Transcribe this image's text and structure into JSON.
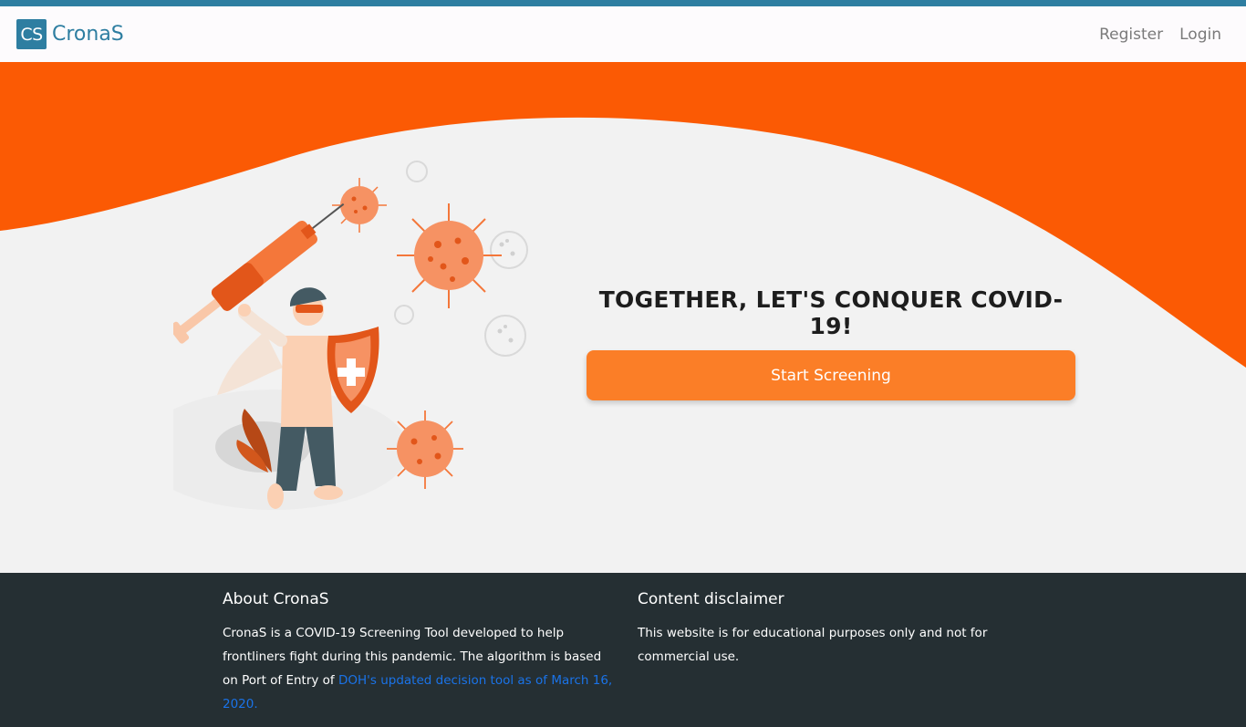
{
  "nav": {
    "brand_badge": "CS",
    "brand_name": "CronaS",
    "register_label": "Register",
    "login_label": "Login"
  },
  "hero": {
    "headline": "TOGETHER, LET'S CONQUER COVID-19!",
    "cta_label": "Start Screening"
  },
  "footer": {
    "about_title": "About CronaS",
    "about_text": "CronaS is a COVID-19 Screening Tool developed to help frontliners fight during this pandemic. The algorithm is based on Port of Entry of ",
    "about_link": "DOH's updated decision tool as of March 16, 2020.",
    "disclaimer_title": "Content disclaimer",
    "disclaimer_text": "This website is for educational purposes only and not for commercial use."
  },
  "colors": {
    "brand": "#2e7ea1",
    "accent": "#fb7e27",
    "wave": "#fb5a04",
    "footer_bg": "#252f33",
    "link": "#1a73e8"
  }
}
